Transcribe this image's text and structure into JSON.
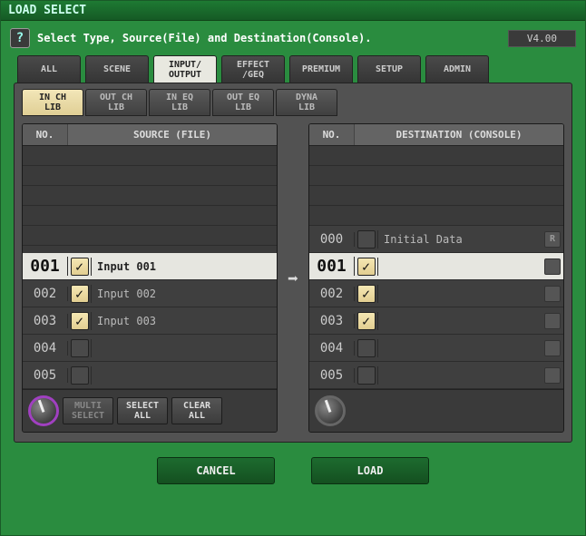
{
  "window_title": "LOAD SELECT",
  "help_text": "Select Type, Source(File) and Destination(Console).",
  "version": "V4.00",
  "topTabs": [
    "ALL",
    "SCENE",
    "INPUT/\nOUTPUT",
    "EFFECT\n/GEQ",
    "PREMIUM",
    "SETUP",
    "ADMIN"
  ],
  "topTabActive": 2,
  "subTabs": [
    "IN CH\nLIB",
    "OUT CH\nLIB",
    "IN EQ\nLIB",
    "OUT EQ\nLIB",
    "DYNA\nLIB"
  ],
  "subTabActive": 0,
  "source": {
    "hdr_no": "NO.",
    "hdr_title": "SOURCE (FILE)",
    "rows": [
      {
        "no": "001",
        "chk": true,
        "name": "Input 001",
        "sel": true
      },
      {
        "no": "002",
        "chk": true,
        "name": "Input 002"
      },
      {
        "no": "003",
        "chk": true,
        "name": "Input 003"
      },
      {
        "no": "004",
        "chk": false,
        "name": ""
      },
      {
        "no": "005",
        "chk": false,
        "name": ""
      }
    ],
    "footer": {
      "multi": "MULTI\nSELECT",
      "selectAll": "SELECT\nALL",
      "clearAll": "CLEAR\nALL"
    }
  },
  "dest": {
    "hdr_no": "NO.",
    "hdr_title": "DESTINATION (CONSOLE)",
    "rows": [
      {
        "no": "000",
        "chk": false,
        "name": "Initial Data",
        "flag": "R"
      },
      {
        "no": "001",
        "chk": true,
        "name": "",
        "sel": true,
        "flag": ""
      },
      {
        "no": "002",
        "chk": true,
        "name": "",
        "flag": ""
      },
      {
        "no": "003",
        "chk": true,
        "name": "",
        "flag": ""
      },
      {
        "no": "004",
        "chk": false,
        "name": "",
        "flag": ""
      },
      {
        "no": "005",
        "chk": false,
        "name": "",
        "flag": ""
      }
    ]
  },
  "buttons": {
    "cancel": "CANCEL",
    "load": "LOAD"
  }
}
